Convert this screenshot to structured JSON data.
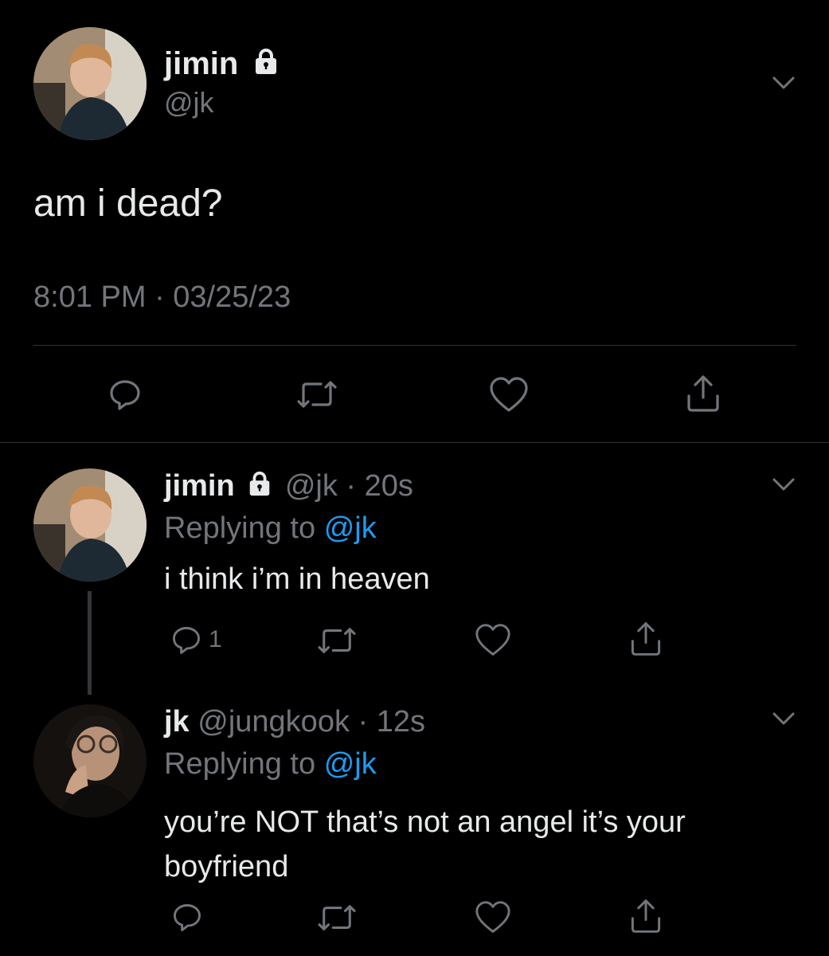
{
  "main_tweet": {
    "author_name": "jimin",
    "author_handle": "@jk",
    "text": "am i dead?",
    "timestamp": "8:01 PM · 03/25/23"
  },
  "reply1": {
    "author_name": "jimin",
    "author_handle": "@jk",
    "time": "· 20s",
    "replying_prefix": "Replying to",
    "replying_handle": "@jk",
    "text": "i think i’m in heaven",
    "reply_count": "1"
  },
  "reply2": {
    "author_name": "jk",
    "author_handle": "@jungkook",
    "time": "· 12s",
    "replying_prefix": "Replying to",
    "replying_handle": "@jk",
    "text": "you’re NOT that’s not an angel it’s your boyfriend"
  },
  "icons": [
    "lock-icon",
    "chevron-down-icon",
    "reply-icon",
    "retweet-icon",
    "like-icon",
    "share-icon"
  ],
  "colors": {
    "background": "#000000",
    "text": "#e7e9ea",
    "muted": "#71767b",
    "link": "#1d9bf0",
    "divider": "#2f3336"
  }
}
